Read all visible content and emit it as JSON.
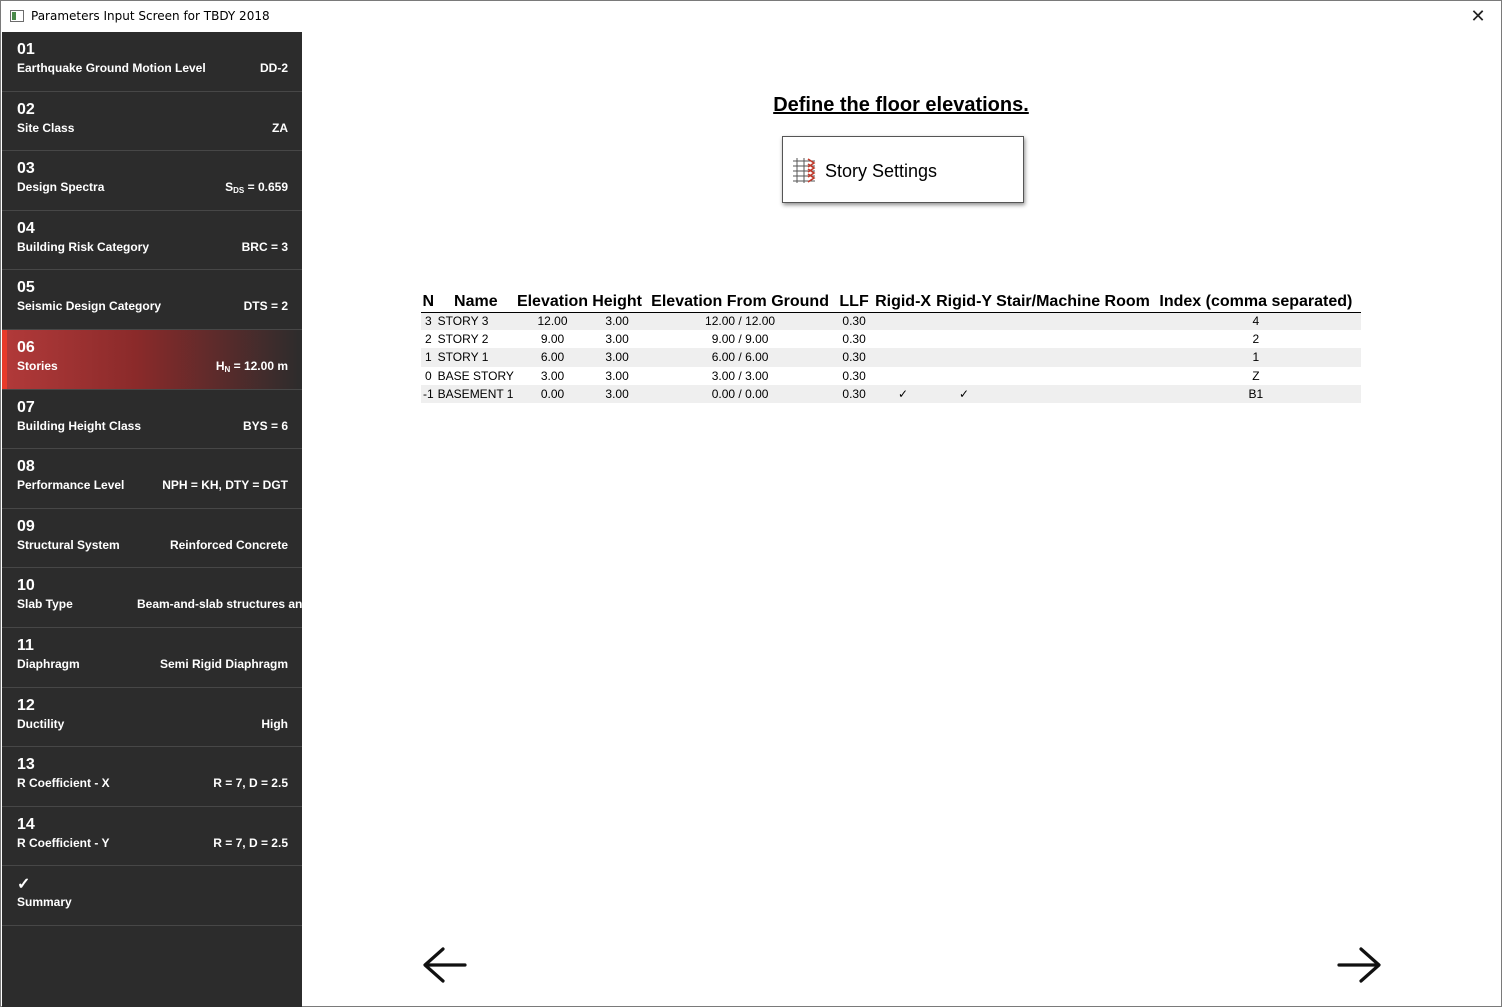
{
  "window": {
    "title": "Parameters Input Screen for TBDY 2018",
    "close_glyph": "✕"
  },
  "sidebar": {
    "items": [
      {
        "num": "01",
        "label": "Earthquake Ground Motion Level",
        "value": "DD-2"
      },
      {
        "num": "02",
        "label": "Site Class",
        "value": "ZA"
      },
      {
        "num": "03",
        "label": "Design Spectra",
        "value_prefix": "S",
        "value_sub": "DS",
        "value": " = 0.659"
      },
      {
        "num": "04",
        "label": "Building Risk Category",
        "value": "BRC = 3"
      },
      {
        "num": "05",
        "label": "Seismic Design Category",
        "value": "DTS = 2"
      },
      {
        "num": "06",
        "label": "Stories",
        "value_prefix": "H",
        "value_sub": "N",
        "value": " = 12.00 m",
        "active": true
      },
      {
        "num": "07",
        "label": "Building Height Class",
        "value": "BYS = 6"
      },
      {
        "num": "08",
        "label": "Performance Level",
        "value": "NPH = KH, DTY = DGT"
      },
      {
        "num": "09",
        "label": "Structural System",
        "value": "Reinforced Concrete"
      },
      {
        "num": "10",
        "label": "Slab Type",
        "value": "Beam-and-slab structures and"
      },
      {
        "num": "11",
        "label": "Diaphragm",
        "value": "Semi Rigid Diaphragm"
      },
      {
        "num": "12",
        "label": "Ductility",
        "value": "High"
      },
      {
        "num": "13",
        "label": "R Coefficient - X",
        "value": "R = 7, D = 2.5"
      },
      {
        "num": "14",
        "label": "R Coefficient - Y",
        "value": "R = 7, D = 2.5"
      }
    ],
    "summary": {
      "check": "✓",
      "label": "Summary"
    }
  },
  "main": {
    "heading": "Define the floor elevations.",
    "story_button_label": "Story Settings",
    "table": {
      "columns": [
        "N",
        "Name",
        "Elevation",
        "Height",
        "Elevation From Ground",
        "LLF",
        "Rigid-X",
        "Rigid-Y",
        "Stair/Machine Room",
        "Index (comma separated)"
      ],
      "rows": [
        [
          "3",
          "STORY 3",
          "12.00",
          "3.00",
          "12.00 / 12.00",
          "0.30",
          "",
          "",
          "",
          "4"
        ],
        [
          "2",
          "STORY 2",
          "9.00",
          "3.00",
          "9.00 / 9.00",
          "0.30",
          "",
          "",
          "",
          "2"
        ],
        [
          "1",
          "STORY 1",
          "6.00",
          "3.00",
          "6.00 / 6.00",
          "0.30",
          "",
          "",
          "",
          "1"
        ],
        [
          "0",
          "BASE STORY",
          "3.00",
          "3.00",
          "3.00 / 3.00",
          "0.30",
          "",
          "",
          "",
          "Z"
        ],
        [
          "-1",
          "BASEMENT 1",
          "0.00",
          "3.00",
          "0.00 / 0.00",
          "0.30",
          "✓",
          "✓",
          "",
          "B1"
        ]
      ]
    }
  },
  "colors": {
    "sidebar_bg": "#2c2c2c",
    "active_accent": "#e83a2a",
    "active_gradient": "#b23a3a"
  }
}
